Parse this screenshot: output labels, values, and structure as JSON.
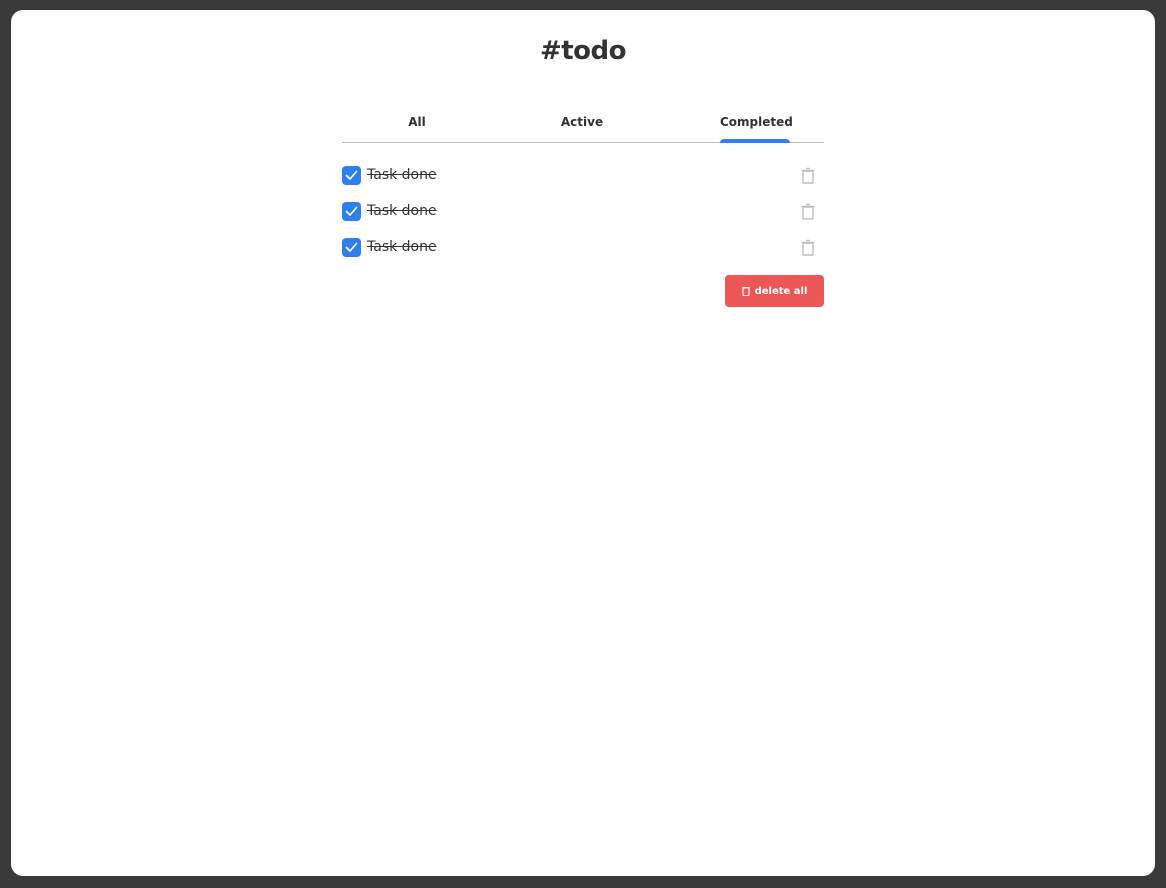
{
  "app": {
    "title": "#todo"
  },
  "tabs": [
    {
      "label": "All"
    },
    {
      "label": "Active"
    },
    {
      "label": "Completed",
      "selected": true
    }
  ],
  "tasks": [
    {
      "label": "Task done",
      "completed": true,
      "icon": "trash-icon"
    },
    {
      "label": "Task done",
      "completed": true,
      "icon": "trash-icon"
    },
    {
      "label": "Task done",
      "completed": true,
      "icon": "trash-icon"
    }
  ],
  "actions": {
    "delete_all_label": "delete all",
    "delete_all_icon": "trash-icon"
  },
  "colors": {
    "accent": "#2f80ed",
    "danger": "#eb5757",
    "text": "#333333",
    "muted_icon": "#bdbdbd"
  }
}
